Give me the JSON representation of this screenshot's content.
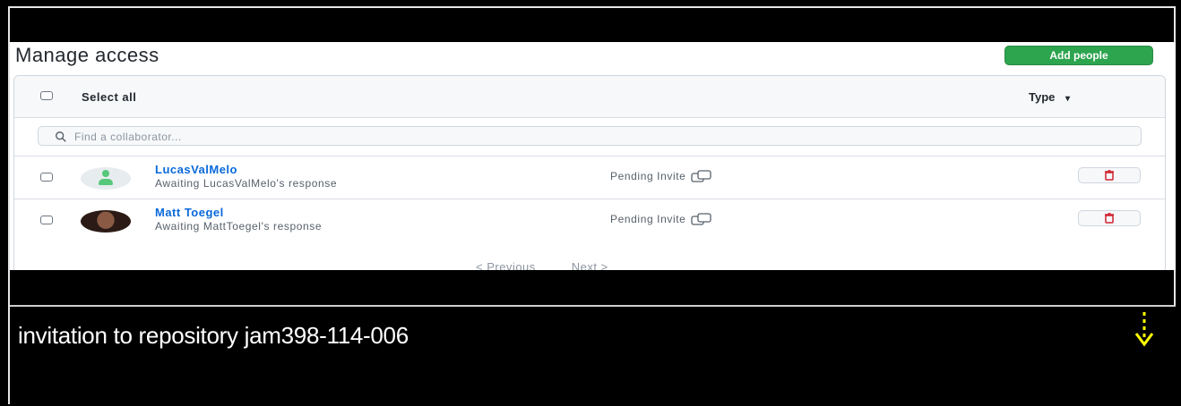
{
  "manage": {
    "title": "Manage access",
    "add_button": "Add people",
    "select_all": "Select all",
    "type_filter": "Type",
    "type_caret": "▾",
    "search_placeholder": "Find a collaborator..."
  },
  "collaborators": [
    {
      "name": "LucasValMelo",
      "subtitle": "Awaiting LucasValMelo's response",
      "status": "Pending Invite",
      "avatar": "default-avatar"
    },
    {
      "name": "Matt Toegel",
      "subtitle": "Awaiting MattToegel's response",
      "status": "Pending Invite",
      "avatar": "photo-avatar"
    }
  ],
  "pagination": {
    "previous": "< Previous",
    "next": "Next >"
  },
  "caption": {
    "text": "invitation to repository jam398-114-006"
  },
  "colors": {
    "accent_green": "#2da44e",
    "link_blue": "#0969da",
    "danger_red": "#cf222e",
    "arrow_yellow": "#ffff00"
  },
  "icons": [
    "search-icon",
    "copy-icon",
    "trash-icon",
    "down-arrow-icon"
  ]
}
